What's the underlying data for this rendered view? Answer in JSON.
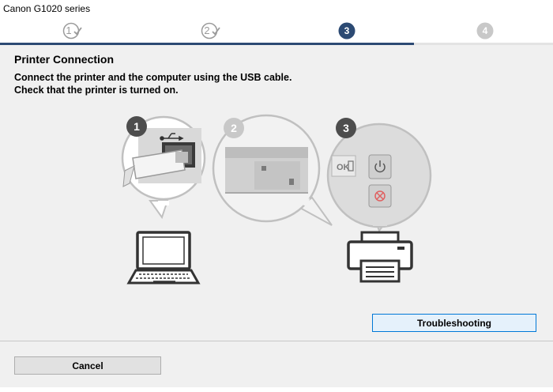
{
  "window": {
    "title": "Canon G1020 series"
  },
  "steps": [
    {
      "label": "1",
      "state": "done"
    },
    {
      "label": "2",
      "state": "done"
    },
    {
      "label": "3",
      "state": "active"
    },
    {
      "label": "4",
      "state": "todo"
    }
  ],
  "page": {
    "heading": "Printer Connection",
    "instructions": [
      "Connect the printer and the computer using the USB cable.",
      "Check that the printer is turned on."
    ]
  },
  "illustration": {
    "callouts": [
      "1",
      "2",
      "3"
    ],
    "panel_ok_label": "OK",
    "icons": [
      "usb-icon",
      "laptop-icon",
      "printer-icon",
      "power-icon",
      "stop-icon"
    ]
  },
  "buttons": {
    "troubleshooting": "Troubleshooting",
    "cancel": "Cancel"
  },
  "colors": {
    "accent": "#2c4a73",
    "inactive_step": "#c8c8c8",
    "done_step": "#9b9b9b"
  }
}
